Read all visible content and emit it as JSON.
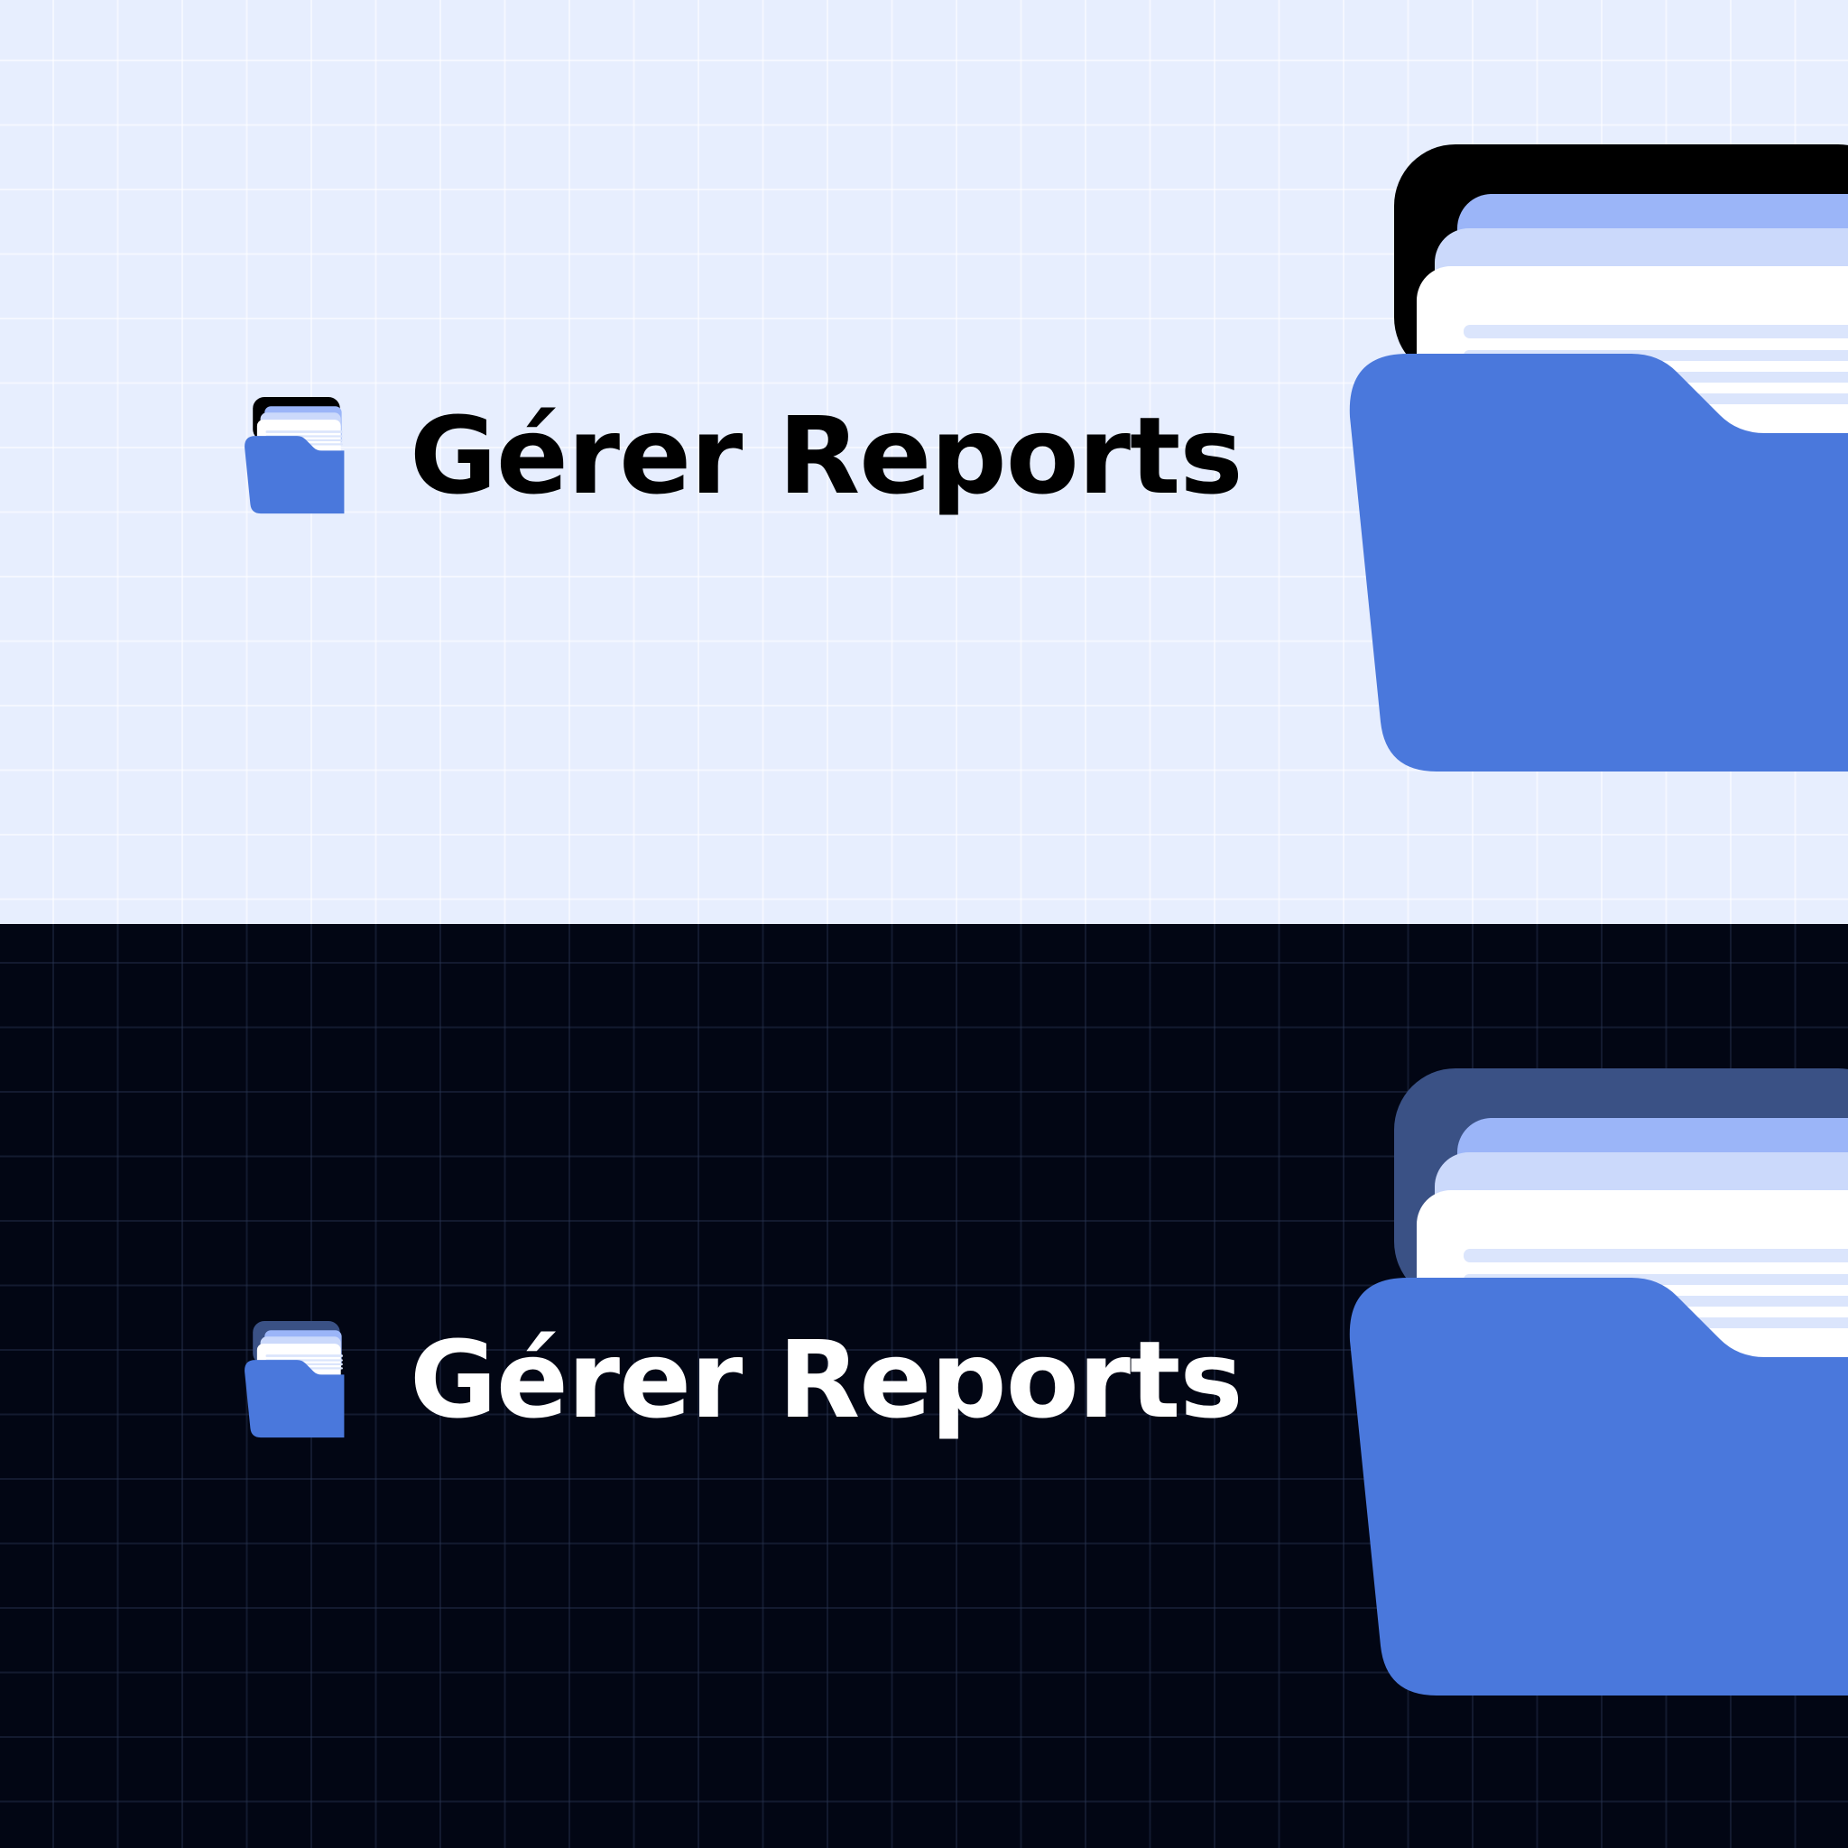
{
  "brand": {
    "name": "Gérer Reports"
  },
  "colors": {
    "light_background": "#e7eefe",
    "dark_background": "#020614",
    "folder_blue": "#4a78dc",
    "paper_back": "#9bb5f8",
    "paper_middle": "#cbd9fb",
    "paper_front": "#ffffff",
    "folder_back_light": "#000000",
    "folder_back_dark": "#3a5185"
  },
  "icons": {
    "logo_mark": "folder-with-reports-icon",
    "hero": "folder-with-reports-icon"
  }
}
